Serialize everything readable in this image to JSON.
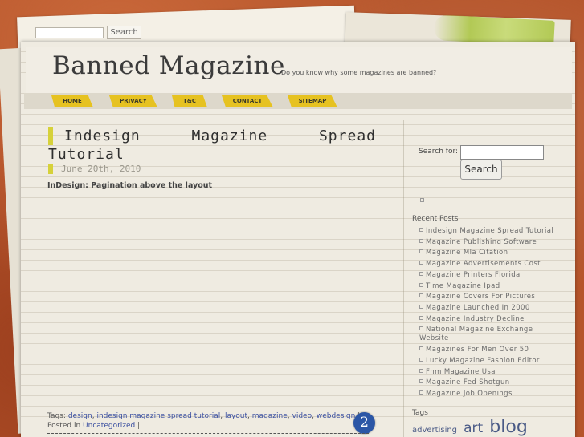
{
  "top_search": {
    "button_label": "Search"
  },
  "header": {
    "site_title": "Banned Magazine",
    "tagline": "Do you know why some magazines are banned?"
  },
  "nav": {
    "items": [
      "HOME",
      "PRIVACY",
      "T&C",
      "CONTACT",
      "SITEMAP"
    ]
  },
  "post": {
    "title_line1": [
      "Indesign",
      "Magazine",
      "Spread"
    ],
    "title_line2": "Tutorial",
    "date": "June 20th, 2010",
    "excerpt": "InDesign: Pagination above the layout",
    "tags_label": "Tags:",
    "tags": [
      "design",
      "indesign magazine spread tutorial",
      "layout",
      "magazine",
      "video",
      "webdesign"
    ],
    "tags_tail": "|",
    "posted_in_label": "Posted in",
    "category": "Uncategorized",
    "category_tail": "|",
    "comment_count": "2"
  },
  "sidebar": {
    "search_label": "Search for:",
    "search_button": "Search",
    "recent_posts_heading": "Recent Posts",
    "recent_posts": [
      "Indesign Magazine Spread Tutorial",
      "Magazine Publishing Software",
      "Magazine Mla Citation",
      "Magazine Advertisements Cost",
      "Magazine Printers Florida",
      "Time Magazine Ipad",
      "Magazine Covers For Pictures",
      "Magazine Launched In 2000",
      "Magazine Industry Decline",
      "National Magazine Exchange Website",
      "Magazines For Men Over 50",
      "Lucky Magazine Fashion Editor",
      "Fhm Magazine Usa",
      "Magazine Fed Shotgun",
      "Magazine Job Openings"
    ],
    "tags_heading": "Tags",
    "tag_cloud": [
      "advertising",
      "art",
      "blog"
    ]
  },
  "colors": {
    "background": "#b5542a",
    "nav_tab": "#e6c221",
    "title_marker": "#d6d13a",
    "comment_badge": "#2b56a6",
    "link": "#3a4fa0"
  }
}
